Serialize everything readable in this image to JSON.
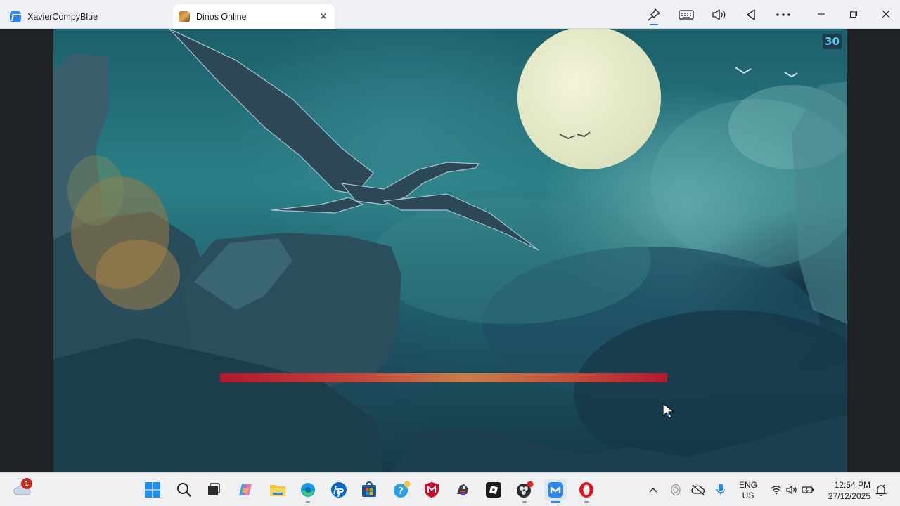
{
  "browser": {
    "app_tab_label": "XavierCompyBlue",
    "active_tab_label": "Dinos Online",
    "close_glyph": "✕"
  },
  "game": {
    "fps_counter": "30",
    "loading_progress": 1.0
  },
  "taskbar": {
    "weather_badge": "1",
    "language_line1": "ENG",
    "language_line2": "US",
    "time": "12:54 PM",
    "date": "27/12/2025"
  }
}
